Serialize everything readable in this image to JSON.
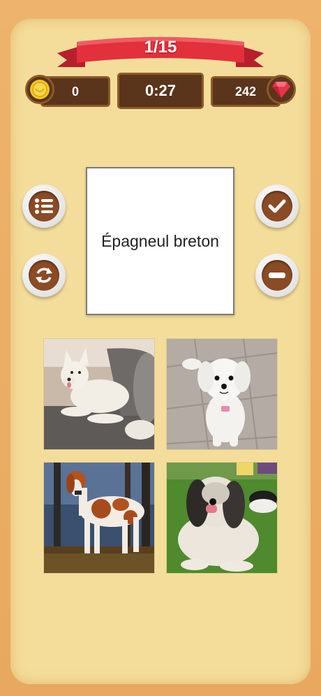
{
  "level": {
    "progress": "1/15"
  },
  "stats": {
    "coins": "0",
    "timer": "0:27",
    "gems": "242"
  },
  "word_card": {
    "text": "Épagneul breton"
  },
  "icons": {
    "coin": "coin-icon",
    "gem": "gem-icon",
    "list": "list-icon",
    "refresh": "refresh-icon",
    "check": "check-icon",
    "minus": "minus-icon"
  },
  "photos": [
    {
      "subject": "white spitz dog on a gray couch"
    },
    {
      "subject": "small white fluffy dog on tiles"
    },
    {
      "subject": "orange and white spaniel in a forest"
    },
    {
      "subject": "long-haired black and white dog on grass"
    }
  ],
  "colors": {
    "background": "#eab06a",
    "panel": "#f4dd9a",
    "ribbon": "#e2303d",
    "wood": "#5b341c",
    "button_inner": "#8b4b25"
  }
}
